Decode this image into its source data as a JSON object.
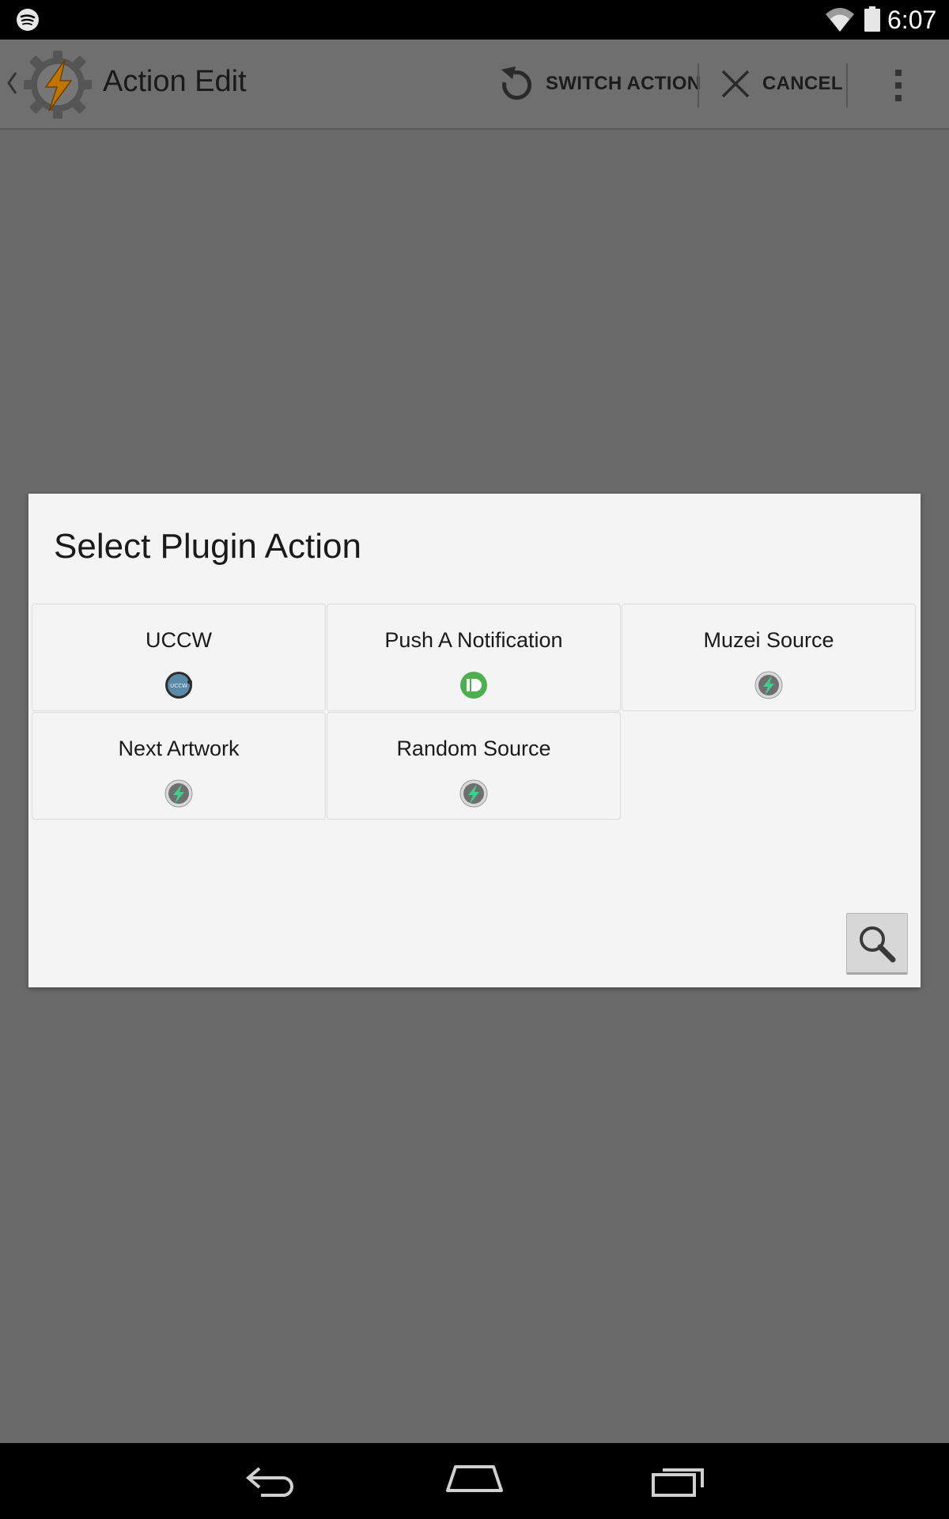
{
  "status_bar": {
    "time": "6:07",
    "icons": [
      "spotify-icon",
      "wifi-icon",
      "battery-icon"
    ]
  },
  "action_bar": {
    "title": "Action Edit",
    "switch_action_label": "SWITCH ACTION",
    "cancel_label": "CANCEL",
    "icons": [
      "back-chevron-icon",
      "tasker-app-icon",
      "refresh-icon",
      "close-icon",
      "overflow-menu-icon"
    ]
  },
  "dialog": {
    "title": "Select Plugin Action",
    "plugins": [
      {
        "label": "UCCW",
        "icon": "uccw-icon",
        "icon_text": "UCCW"
      },
      {
        "label": "Push A Notification",
        "icon": "pushbullet-icon"
      },
      {
        "label": "Muzei Source",
        "icon": "bolt-icon"
      },
      {
        "label": "Next Artwork",
        "icon": "bolt-icon"
      },
      {
        "label": "Random Source",
        "icon": "bolt-icon"
      }
    ],
    "search_icon": "search-icon"
  },
  "nav_bar": {
    "icons": [
      "back-icon",
      "home-icon",
      "recents-icon"
    ]
  },
  "colors": {
    "scrim": "#6a6a6a",
    "dialog_bg": "#f4f4f4",
    "bolt_green": "#3ecf8e",
    "pushbullet_green": "#4caf50",
    "tasker_orange": "#e08a00"
  }
}
